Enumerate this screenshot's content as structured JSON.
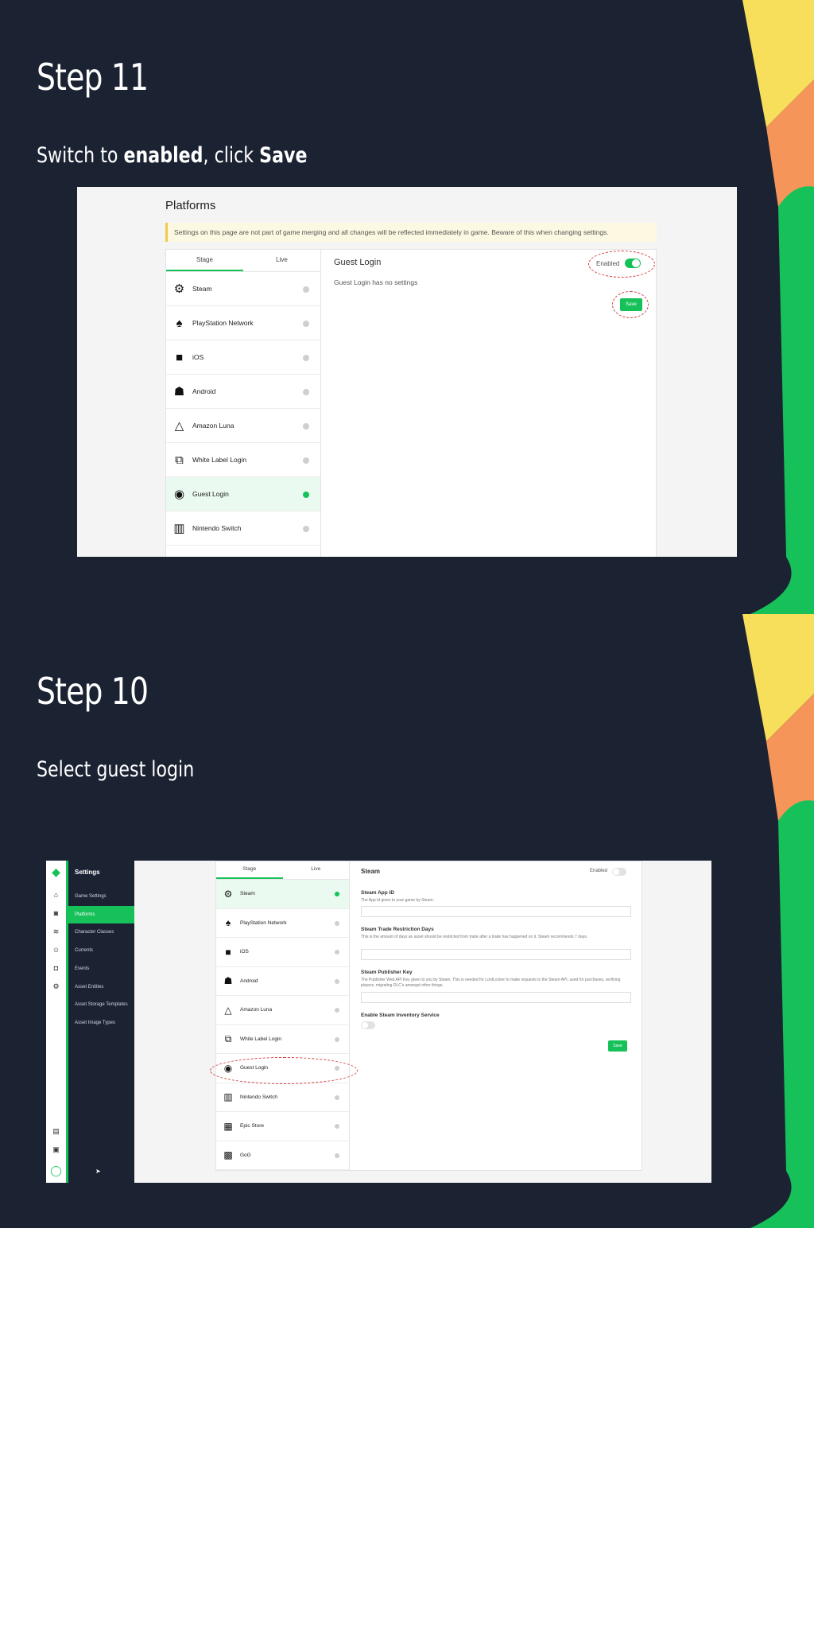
{
  "colors": {
    "slide_bg": "#1b2333",
    "accent_green": "#17c15a",
    "yellow": "#f7df5c",
    "orange": "#f5955a",
    "annotation_red": "#d43a3a"
  },
  "step11": {
    "title": "Step 11",
    "subtitle_pre": "Switch to ",
    "subtitle_bold1": "enabled",
    "subtitle_mid": ", click ",
    "subtitle_bold2": "Save",
    "screen": {
      "page_title": "Platforms",
      "banner": "Settings on this page are not part of game merging and all changes will be reflected immediately in game. Beware of this when changing settings.",
      "tabs": [
        "Stage",
        "Live"
      ],
      "platforms": [
        {
          "label": "Steam",
          "icon": "steam-icon"
        },
        {
          "label": "PlayStation Network",
          "icon": "playstation-icon"
        },
        {
          "label": "iOS",
          "icon": "apple-icon"
        },
        {
          "label": "Android",
          "icon": "android-icon"
        },
        {
          "label": "Amazon Luna",
          "icon": "luna-icon"
        },
        {
          "label": "White Label Login",
          "icon": "white-label-icon"
        },
        {
          "label": "Guest Login",
          "icon": "eye-icon",
          "selected": true
        },
        {
          "label": "Nintendo Switch",
          "icon": "switch-icon"
        }
      ],
      "detail_title": "Guest Login",
      "detail_text": "Guest Login has no settings",
      "enabled_label": "Enabled",
      "enabled_state": true,
      "save_label": "Save"
    }
  },
  "step10": {
    "title": "Step 10",
    "subtitle": "Select guest login",
    "screen": {
      "nav_header": "Settings",
      "nav_items": [
        "Game Settings",
        "Platforms",
        "Character Classes",
        "Currents",
        "Events",
        "Asset Entities",
        "Asset Storage Templates",
        "Asset Image Types"
      ],
      "active_nav": "Platforms",
      "tabs": [
        "Stage",
        "Live"
      ],
      "platforms": [
        {
          "label": "Steam",
          "icon": "steam-icon",
          "selected": true
        },
        {
          "label": "PlayStation Network",
          "icon": "playstation-icon"
        },
        {
          "label": "iOS",
          "icon": "apple-icon"
        },
        {
          "label": "Android",
          "icon": "android-icon"
        },
        {
          "label": "Amazon Luna",
          "icon": "luna-icon"
        },
        {
          "label": "White Label Login",
          "icon": "white-label-icon"
        },
        {
          "label": "Guest Login",
          "icon": "eye-icon"
        },
        {
          "label": "Nintendo Switch",
          "icon": "switch-icon"
        },
        {
          "label": "Epic Store",
          "icon": "epic-icon"
        },
        {
          "label": "GoG",
          "icon": "gog-icon"
        }
      ],
      "detail_title": "Steam",
      "enabled_label": "Enabled",
      "enabled_state": false,
      "fields": [
        {
          "label": "Steam App ID",
          "help": "The App Id given to your game by Steam."
        },
        {
          "label": "Steam Trade Restriction Days",
          "help": "This is the amount of days an asset should be restricted from trade after a trade has happened on it. Steam recommends 7 days."
        },
        {
          "label": "Steam Publisher Key",
          "help": "The Publisher Web API Key given to you by Steam. This is needed for LootLocker to make requests to the Steam API, used for purchases, verifying players, migrating DLC's amongst other things."
        }
      ],
      "inventory_label": "Enable Steam Inventory Service",
      "save_label": "Save"
    }
  }
}
